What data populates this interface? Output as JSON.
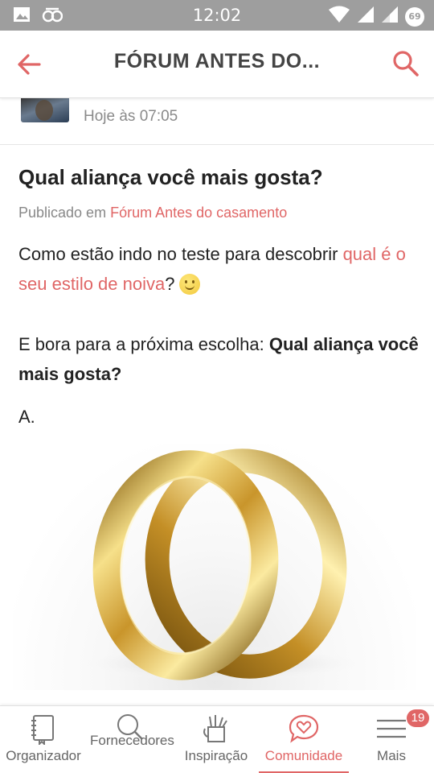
{
  "status_bar": {
    "time": "12:02",
    "battery": "69",
    "icons": [
      "image-icon",
      "app-icon",
      "wifi-icon",
      "signal-icon",
      "battery-icon"
    ]
  },
  "header": {
    "title": "FÓRUM ANTES DO...",
    "back_icon": "arrow-left-icon",
    "search_icon": "search-icon",
    "accent_color": "#e06666"
  },
  "post": {
    "time": "Hoje às 07:05",
    "title": "Qual aliança você mais gosta?",
    "published_prefix": "Publicado em",
    "forum_name": "Fórum Antes do casamento",
    "para1_text": "Como estão indo no teste para descobrir ",
    "para1_link": "qual é o seu estilo de noiva",
    "para1_suffix": "?",
    "para2_text": "E bora para a próxima escolha: ",
    "para2_bold": "Qual aliança você mais gosta?",
    "option_label": "A."
  },
  "bottom_nav": {
    "items": [
      {
        "label": "Organizador",
        "icon": "notebook-icon"
      },
      {
        "label": "Fornecedores",
        "icon": "search-icon"
      },
      {
        "label": "Inspiração",
        "icon": "pencil-cup-icon"
      },
      {
        "label": "Comunidade",
        "icon": "chat-heart-icon"
      },
      {
        "label": "Mais",
        "icon": "menu-icon"
      }
    ],
    "active": "Comunidade",
    "badge": "19"
  }
}
